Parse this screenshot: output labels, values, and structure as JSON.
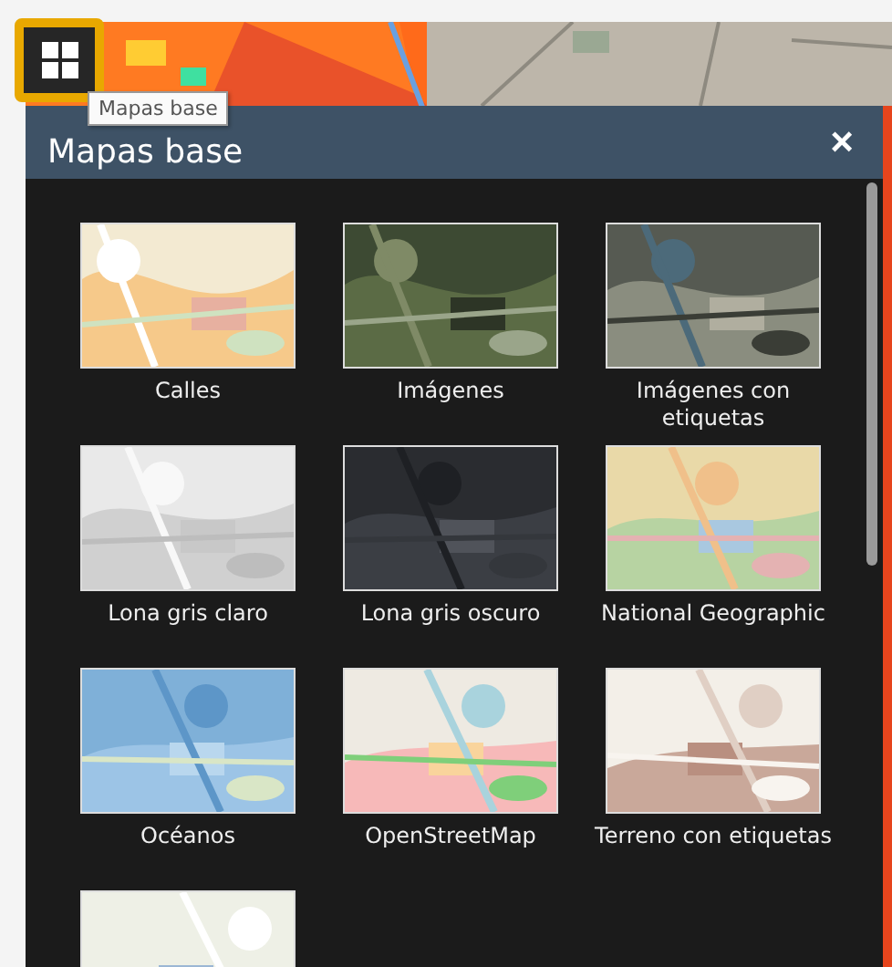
{
  "toolbar": {
    "tooltip": "Mapas base"
  },
  "panel": {
    "title": "Mapas base",
    "close": "×",
    "basemaps": [
      {
        "kind": "basemap",
        "label": "Calles"
      },
      {
        "kind": "basemap",
        "label": "Imágenes"
      },
      {
        "kind": "basemap",
        "label": "Imágenes con etiquetas"
      },
      {
        "kind": "basemap",
        "label": "Lona gris claro"
      },
      {
        "kind": "basemap",
        "label": "Lona gris oscuro"
      },
      {
        "kind": "basemap",
        "label": "National Geographic"
      },
      {
        "kind": "basemap",
        "label": "Océanos"
      },
      {
        "kind": "basemap",
        "label": "OpenStreetMap"
      },
      {
        "kind": "basemap",
        "label": "Terreno con etiquetas"
      },
      {
        "kind": "picture"
      }
    ]
  }
}
